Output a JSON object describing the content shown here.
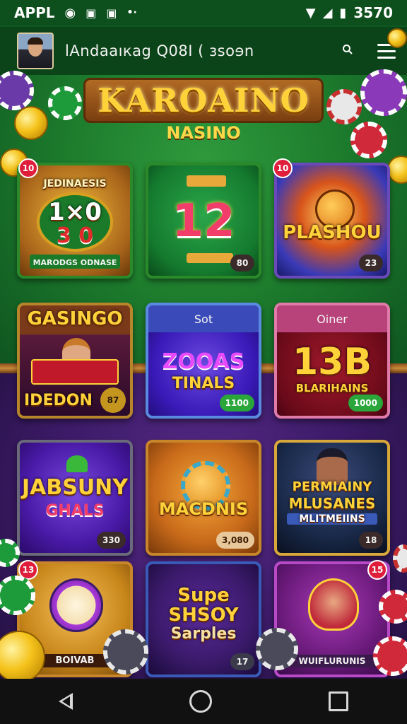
{
  "statusbar": {
    "carrier": "APPL",
    "time": "3570",
    "icons": [
      "target-icon",
      "app-icon",
      "app-icon-2",
      "dots-icon",
      "wifi-icon",
      "signal-icon",
      "battery-icon"
    ]
  },
  "appbar": {
    "title": "lAndaaıкag Q08I ( ɜsoɘn",
    "search_icon": "search-icon",
    "menu_icon": "hamburger-menu-icon"
  },
  "logo": {
    "title": "KAROAINO",
    "subtitle": "NASINO"
  },
  "tiles": [
    {
      "title": "JEDINAESIS",
      "main": "1×0",
      "main2": "3 0",
      "footer": "MARODGS ODNASE",
      "badge": "10",
      "count": ""
    },
    {
      "title": "",
      "main": "12",
      "main2": "",
      "footer": "",
      "badge": "",
      "count": "80"
    },
    {
      "title": "",
      "main": "PLASHOU",
      "main2": "",
      "footer": "",
      "badge": "10",
      "count": "23"
    },
    {
      "title": "",
      "header": "GASINGO",
      "main": "IDEDON",
      "main2": "",
      "footer": "",
      "badge": "",
      "count": "87"
    },
    {
      "title": "",
      "header": "Sot",
      "main": "ZOOAS",
      "main2": "TINALS",
      "footer": "",
      "badge": "",
      "count": "1100"
    },
    {
      "title": "",
      "header": "Oiner",
      "main": "13B",
      "main2": "BLARIHAINS",
      "footer": "",
      "badge": "",
      "count": "1000"
    },
    {
      "title": "",
      "main": "JABSUNY",
      "main2": "GHALS",
      "footer": "",
      "badge": "",
      "count": "330"
    },
    {
      "title": "",
      "main": "MACDNIS",
      "main2": "",
      "footer": "",
      "badge": "",
      "count": "3,080"
    },
    {
      "title": "",
      "main": "PERMIAINY",
      "main2": "MLUSANES",
      "main3": "MLITMEIINS",
      "footer": "",
      "badge": "",
      "count": "18"
    },
    {
      "title": "",
      "main": "",
      "main2": "",
      "footer": "BOIVAB",
      "badge": "13",
      "count": ""
    },
    {
      "title": "",
      "main": "Supe SHSOY",
      "main2": "Sarples",
      "footer": "",
      "badge": "",
      "count": "17"
    },
    {
      "title": "",
      "main": "",
      "main2": "",
      "footer": "WUIFLURUNIS",
      "badge": "15",
      "count": ""
    }
  ],
  "colors": {
    "felt_green": "#1c7a2c",
    "felt_purple": "#3b1a66",
    "gold": "#ffd23a",
    "badge_red": "#e01e3c",
    "count_green": "#2aa63a"
  },
  "navbar": {
    "back_icon": "back-triangle-icon",
    "home_icon": "home-circle-icon",
    "recents_icon": "recents-square-icon"
  }
}
